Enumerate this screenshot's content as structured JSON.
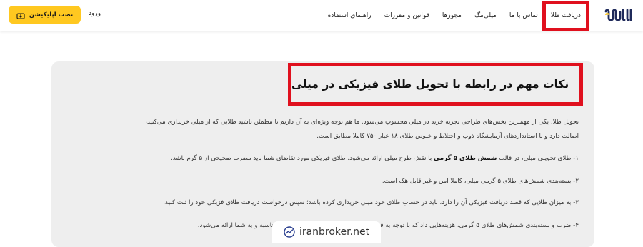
{
  "header": {
    "install_button": "نصب اپلیکیشن",
    "login": "ورود",
    "nav": [
      "راهنمای استفاده",
      "قوانین و مقررات",
      "مجوزها",
      "میلی‌مگ",
      "تماس با ما",
      "دریافت طلا"
    ],
    "highlighted_nav_index": 5,
    "logo": "milli-logo",
    "accent_color": "#ffc820",
    "highlight_color": "#e0101e"
  },
  "article": {
    "title": "نکات مهم در رابطه با تحویل طلای فیزیکی در میلی",
    "intro_line1": "تحویل طلا، یکی از مهمترین بخش‌های طراحی تجربه خرید در میلی محسوب می‌شود. ما هم توجه ویژه‌ای به آن داریم تا مطمئن باشید طلایی که از میلی خریداری می‌کنید،",
    "intro_line2": "اصالت دارد و با استانداردهای آزمایشگاه ذوب و اختلاط و خلوص طلای ۱۸ عیار ۷۵۰ کاملا مطابق است.",
    "point1_before": "۱- طلای تحویلی میلی، در قالب ",
    "point1_bold": "شمش طلای ۵ گرمی",
    "point1_after": " با نقش طرح میلی ارائه می‌شود. طلای فیزیکی مورد تقاضای شما باید مضرب صحیحی از ۵ گرم باشد.",
    "point2": "۲- بسته‌بندی شمش‌های طلای ۵ گرمی میلی، کاملا امن و غیر قابل هک است.",
    "point3": "۳- به میزان طلایی که قصد دریافت فیزیکی آن را دارد، باید در حساب طلای خود میلی خریداری کرده باشد؛ سپس درخواست دریافت طلای فزیکی خود را ثبت کنید.",
    "point4": "۴- ضرب و بسته‌بندی شمش‌های طلای ۵ گرمی، هزینه‌هایی داد که با توجه به قیمت روز طلای فیزیکی، به‌صورت میلی محاسبه و به شما ارائه می‌شود."
  },
  "watermark": {
    "text": "iranbroker.net",
    "icon": "chart-trend-icon"
  }
}
